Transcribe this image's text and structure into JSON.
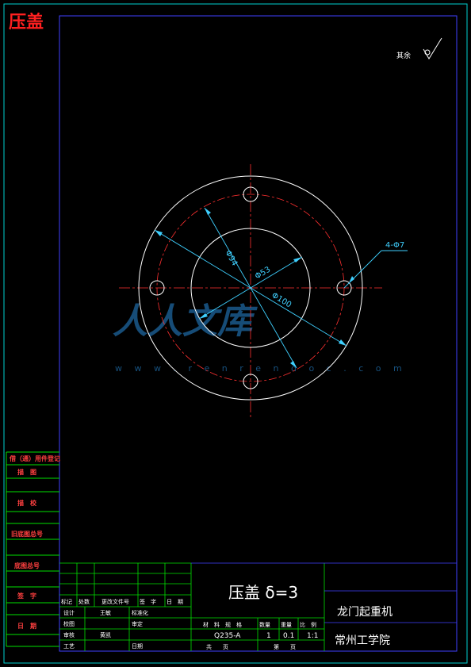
{
  "header": {
    "title": "压盖"
  },
  "roughness": {
    "label": "其余"
  },
  "callouts": {
    "holes": "4-Φ7",
    "d94": "Φ94",
    "d53": "Φ53",
    "d100": "Φ100"
  },
  "watermark": {
    "text": "人人文库",
    "url": "w w w . r e n r e n d o c . c o m"
  },
  "left_strip": {
    "labels": [
      "借（通）用件登记",
      "描　图",
      "描　校",
      "旧底图总号",
      "底图总号",
      "签　字",
      "日　期"
    ]
  },
  "title_block": {
    "part_name": "压盖 δ=3",
    "project": "龙门起重机",
    "school": "常州工学院",
    "rev_header": [
      "标记",
      "处数",
      "更改文件号",
      "签　字",
      "日　期"
    ],
    "sign_rows": [
      {
        "role": "设计",
        "name": "王敏",
        "role2": "标准化"
      },
      {
        "role": "校图",
        "name": "",
        "role2": ""
      },
      {
        "role": "审核",
        "name": "黄凯",
        "role2": "审定"
      },
      {
        "role": "工艺",
        "name": "",
        "role2": "日期"
      }
    ],
    "material_header": [
      "材　料　规　格",
      "数量",
      "重量",
      "比　例"
    ],
    "material": "Q235-A",
    "quantity": "1",
    "weight": "0.1",
    "scale": "1:1",
    "sheet_total": "共　　页",
    "sheet_no": "第　　页"
  }
}
